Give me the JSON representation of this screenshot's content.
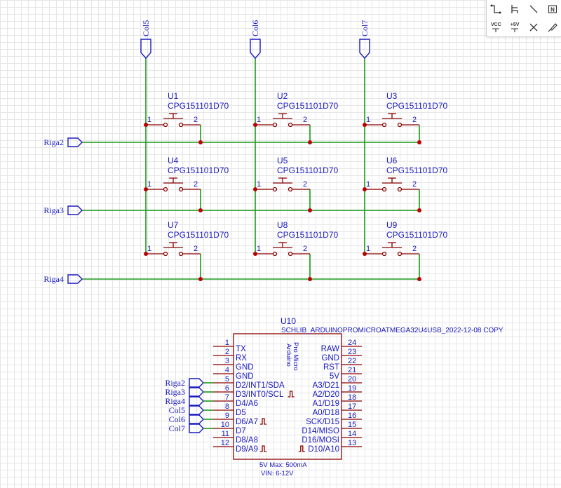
{
  "grid": {
    "column_ports": [
      "Col5",
      "Col6",
      "Col7"
    ],
    "row_ports": [
      "Riga2",
      "Riga3",
      "Riga4"
    ]
  },
  "switches": [
    {
      "designator": "U1",
      "value": "CPG151101D70",
      "pin1": "1",
      "pin2": "2"
    },
    {
      "designator": "U2",
      "value": "CPG151101D70",
      "pin1": "1",
      "pin2": "2"
    },
    {
      "designator": "U3",
      "value": "CPG151101D70",
      "pin1": "1",
      "pin2": "2"
    },
    {
      "designator": "U4",
      "value": "CPG151101D70",
      "pin1": "1",
      "pin2": "2"
    },
    {
      "designator": "U5",
      "value": "CPG151101D70",
      "pin1": "1",
      "pin2": "2"
    },
    {
      "designator": "U6",
      "value": "CPG151101D70",
      "pin1": "1",
      "pin2": "2"
    },
    {
      "designator": "U7",
      "value": "CPG151101D70",
      "pin1": "1",
      "pin2": "2"
    },
    {
      "designator": "U8",
      "value": "CPG151101D70",
      "pin1": "1",
      "pin2": "2"
    },
    {
      "designator": "U9",
      "value": "CPG151101D70",
      "pin1": "1",
      "pin2": "2"
    }
  ],
  "mcu": {
    "designator": "U10",
    "value": "SCHLIB_ARDUINOPROMICROATMEGA32U4USB_2022-12-08 COPY",
    "body_label_line1": "Arduino",
    "body_label_line2": "Pro Micro",
    "left_pins": [
      {
        "num": "1",
        "name": "TX"
      },
      {
        "num": "2",
        "name": "RX"
      },
      {
        "num": "3",
        "name": "GND"
      },
      {
        "num": "4",
        "name": "GND"
      },
      {
        "num": "5",
        "name": "D2/INT1/SDA"
      },
      {
        "num": "6",
        "name": "D3/INT0/SCL"
      },
      {
        "num": "7",
        "name": "D4/A6"
      },
      {
        "num": "8",
        "name": "D5"
      },
      {
        "num": "9",
        "name": "D6/A7"
      },
      {
        "num": "10",
        "name": "D7"
      },
      {
        "num": "11",
        "name": "D8/A8"
      },
      {
        "num": "12",
        "name": "D9/A9"
      }
    ],
    "right_pins": [
      {
        "num": "24",
        "name": "RAW"
      },
      {
        "num": "23",
        "name": "GND"
      },
      {
        "num": "22",
        "name": "RST"
      },
      {
        "num": "21",
        "name": "5V"
      },
      {
        "num": "20",
        "name": "A3/D21"
      },
      {
        "num": "19",
        "name": "A2/D20"
      },
      {
        "num": "18",
        "name": "A1/D19"
      },
      {
        "num": "17",
        "name": "A0/D18"
      },
      {
        "num": "16",
        "name": "SCK/D15"
      },
      {
        "num": "15",
        "name": "D14/MISO"
      },
      {
        "num": "14",
        "name": "D16/MOSI"
      },
      {
        "num": "13",
        "name": "D10/A10"
      }
    ],
    "net_labels": [
      "Riga2",
      "Riga3",
      "Riga4",
      "Col5",
      "Col6",
      "Col7"
    ],
    "note_line1": "5V Max: 500mA",
    "note_line2": "VIN: 6-12V"
  },
  "toolbar": {
    "tools": [
      {
        "icon": "wire-icon"
      },
      {
        "icon": "bus-icon"
      },
      {
        "icon": "line-icon"
      },
      {
        "icon": "net-flag-n-icon",
        "label": "N"
      },
      {
        "icon": "vcc-icon",
        "label": "VCC"
      },
      {
        "icon": "plus-5v-icon",
        "label": "+5V"
      },
      {
        "icon": "no-connect-icon"
      },
      {
        "icon": "probe-icon"
      }
    ]
  },
  "colors": {
    "wire": "#1a9a1a",
    "symbol": "#8b0000",
    "junction": "#c00000",
    "text": "#1a1ac0",
    "grid": "#e6e6e6"
  }
}
